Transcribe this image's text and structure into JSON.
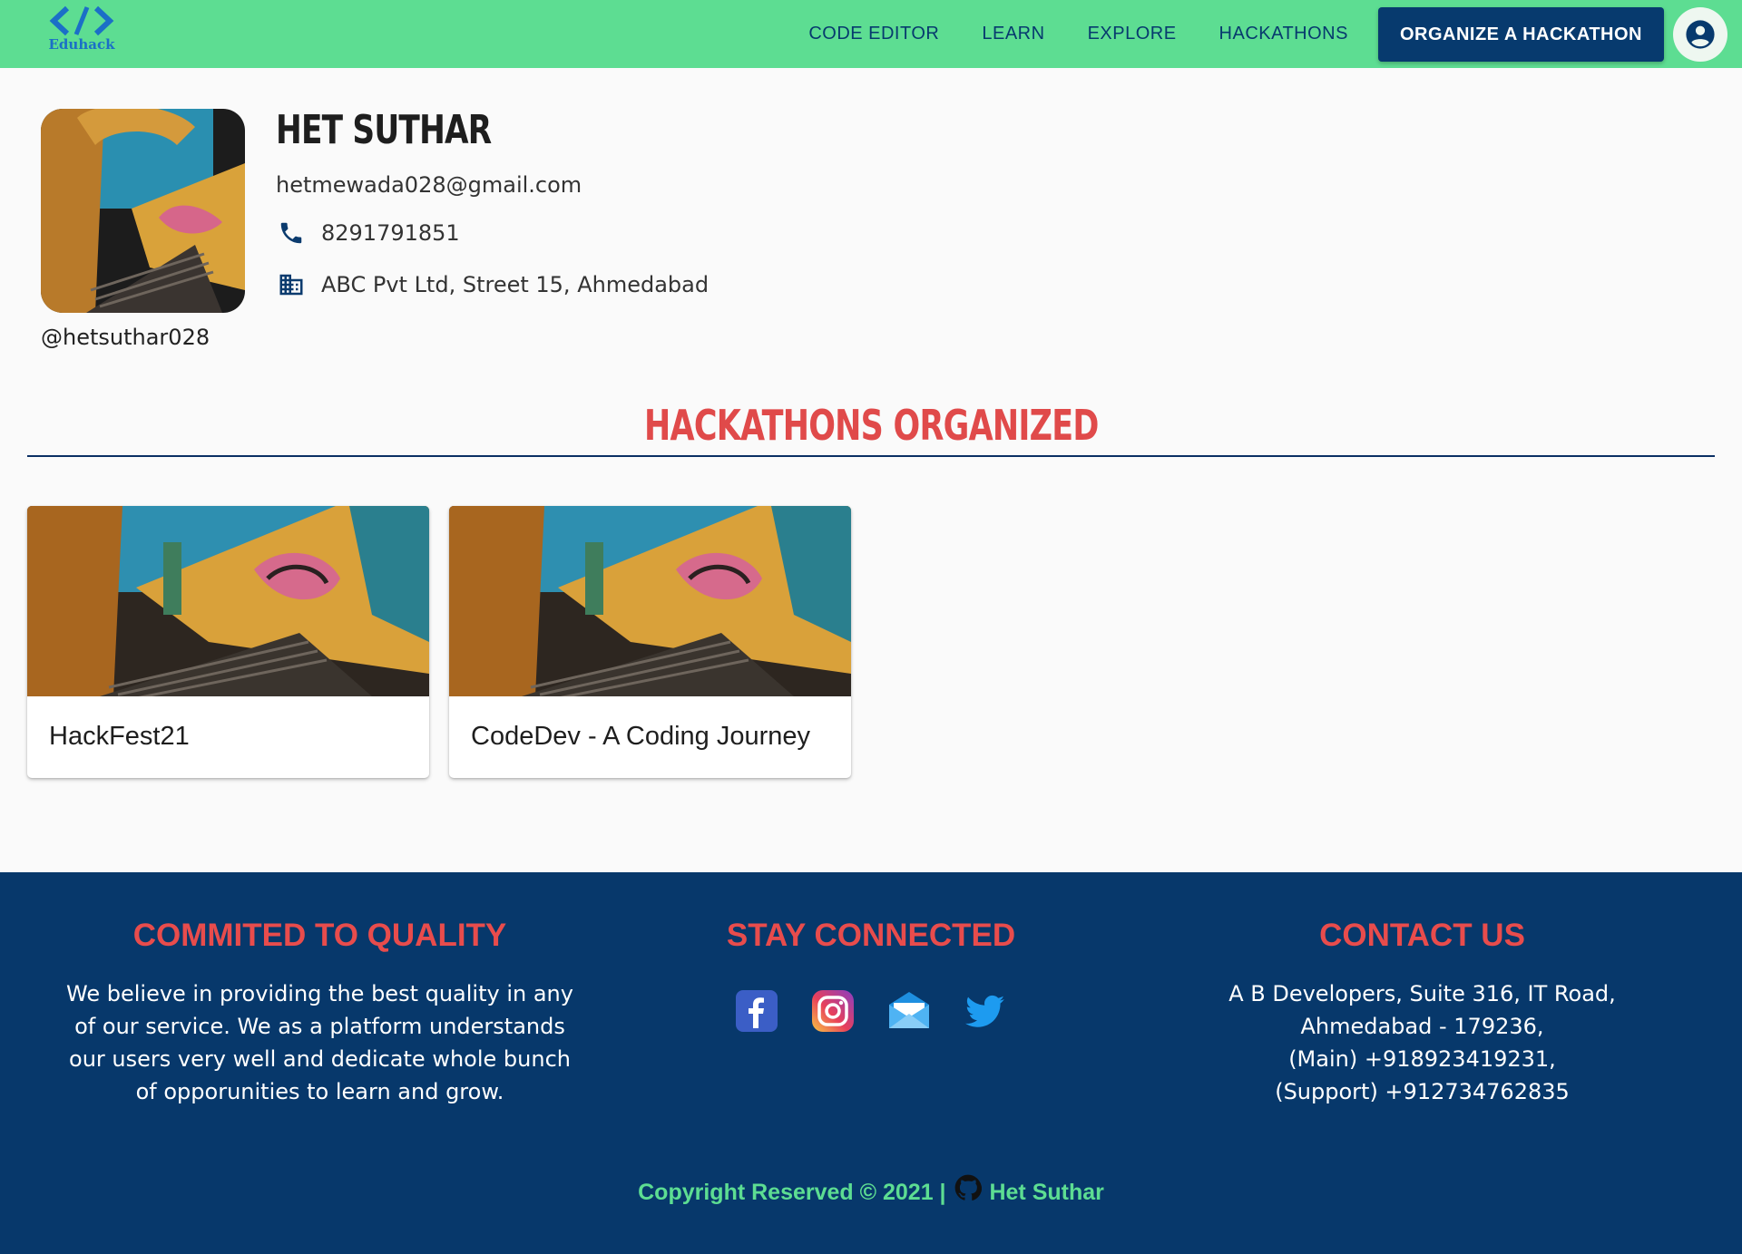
{
  "nav": {
    "logo_text": "Eduhack",
    "links": [
      "CODE EDITOR",
      "LEARN",
      "EXPLORE",
      "HACKATHONS"
    ],
    "cta_label": "ORGANIZE A HACKATHON",
    "icons": {
      "logo": "code-brackets-icon",
      "account": "account-circle-icon"
    }
  },
  "profile": {
    "name": "HET SUTHAR",
    "email": "hetmewada028@gmail.com",
    "phone": "8291791851",
    "address": "ABC Pvt Ltd, Street 15, Ahmedabad",
    "username": "@hetsuthar028",
    "icons": {
      "phone": "phone-icon",
      "address": "building-icon"
    }
  },
  "section": {
    "title": "HACKATHONS ORGANIZED"
  },
  "hackathons": [
    {
      "title": "HackFest21"
    },
    {
      "title": "CodeDev - A Coding Journey"
    }
  ],
  "footer": {
    "quality": {
      "heading": "COMMITED TO QUALITY",
      "body": "We believe in providing the best quality in any of our service. We as a platform understands our users very well and dedicate whole bunch of opporunities to learn and grow."
    },
    "connected": {
      "heading": "STAY CONNECTED",
      "icons": [
        "facebook-icon",
        "instagram-icon",
        "mail-icon",
        "twitter-icon"
      ]
    },
    "contact": {
      "heading": "CONTACT US",
      "lines": [
        "A B Developers, Suite 316, IT Road, Ahmedabad - 179236,",
        "(Main) +918923419231,",
        "(Support) +912734762835"
      ]
    },
    "copyright_prefix": "Copyright Reserved © 2021 |",
    "copyright_author": "Het Suthar"
  },
  "colors": {
    "nav_bg": "#5ddd92",
    "primary": "#073a6e",
    "accent_red": "#e04a4a",
    "footer_bg": "#07386b"
  }
}
